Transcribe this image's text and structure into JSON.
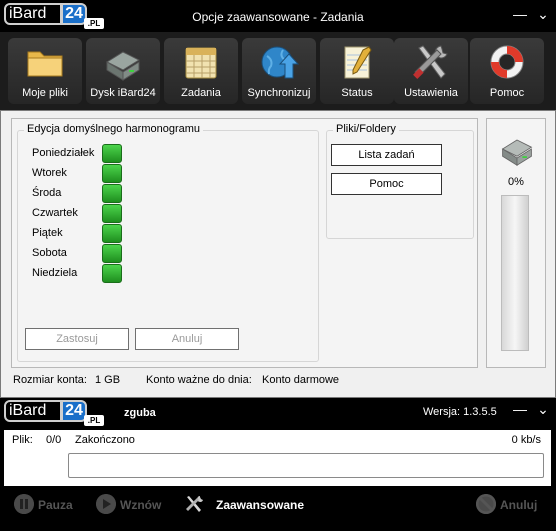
{
  "app": {
    "logo_word": "iBard",
    "logo_num": "24",
    "logo_pl": ".PL",
    "window_title": "Opcje zaawansowane - Zadania",
    "minimize": "—",
    "collapse": "⌄"
  },
  "toolbar": {
    "items": [
      {
        "label": "Moje pliki",
        "icon": "folder-icon"
      },
      {
        "label": "Dysk iBard24",
        "icon": "hard-drive-icon"
      },
      {
        "label": "Zadania",
        "icon": "calendar-icon"
      },
      {
        "label": "Synchronizuj",
        "icon": "globe-sync-icon"
      },
      {
        "label": "Status",
        "icon": "notepad-icon"
      },
      {
        "label": "Ustawienia",
        "icon": "tools-icon"
      },
      {
        "label": "Pomoc",
        "icon": "lifebuoy-icon"
      }
    ]
  },
  "schedule": {
    "group_title": "Edycja domyślnego harmonogramu",
    "days": [
      {
        "name": "Poniedziałek",
        "enabled": true
      },
      {
        "name": "Wtorek",
        "enabled": true
      },
      {
        "name": "Środa",
        "enabled": true
      },
      {
        "name": "Czwartek",
        "enabled": true
      },
      {
        "name": "Piątek",
        "enabled": true
      },
      {
        "name": "Sobota",
        "enabled": true
      },
      {
        "name": "Niedziela",
        "enabled": true
      }
    ],
    "apply_label": "Zastosuj",
    "cancel_label": "Anuluj"
  },
  "files": {
    "group_title": "Pliki/Foldery",
    "task_list_label": "Lista zadań",
    "help_label": "Pomoc"
  },
  "storage": {
    "percent_label": "0%",
    "fill_percent": 0
  },
  "account": {
    "size_label": "Rozmiar konta:",
    "size_value": "1 GB",
    "valid_label": "Konto ważne do dnia:",
    "valid_value": "Konto darmowe"
  },
  "status_window": {
    "user": "zguba",
    "version": "Wersja: 1.3.5.5",
    "file_label": "Plik:",
    "file_count": "0/0",
    "file_status": "Zakończono",
    "speed": "0 kb/s",
    "pause_label": "Pauza",
    "resume_label": "Wznów",
    "advanced_label": "Zaawansowane",
    "cancel_label": "Anuluj"
  },
  "colors": {
    "accent": "#1a6fc9",
    "switch_on": "#2fae2f",
    "toolbar_bg": "#1c1c1c"
  }
}
